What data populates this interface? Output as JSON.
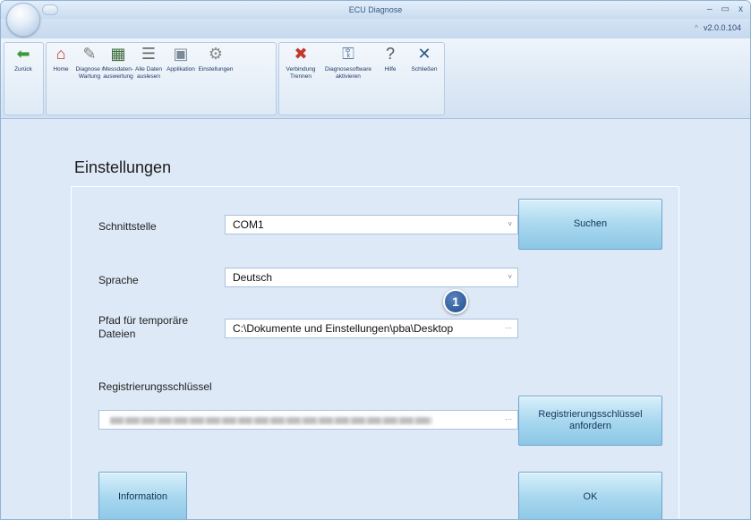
{
  "window": {
    "title": "ECU Diagnose",
    "controls": [
      "–",
      "▭",
      "x"
    ],
    "version": "v2.0.0.104",
    "version_caret": "^"
  },
  "ribbon": {
    "buttons": [
      {
        "label": "Zurück",
        "icon": "back-arrow-icon",
        "glyph": "⬅",
        "color": "#3a9a3a"
      },
      {
        "label": "Home",
        "icon": "home-icon",
        "glyph": "⌂",
        "color": "#c0392b"
      },
      {
        "label": "Diagnose / Wartung",
        "icon": "tools-icon",
        "glyph": "✎",
        "color": "#7a7a7a"
      },
      {
        "label": "Messdaten-auswertung",
        "icon": "measurement-icon",
        "glyph": "▦",
        "color": "#3a6a3a"
      },
      {
        "label": "Alle Daten auslesen",
        "icon": "database-icon",
        "glyph": "☰",
        "color": "#6a6a6a"
      },
      {
        "label": "Applikation",
        "icon": "application-icon",
        "glyph": "▣",
        "color": "#7a8a9a"
      },
      {
        "label": "Einstellungen",
        "icon": "gears-icon",
        "glyph": "⚙",
        "color": "#8a8a8a"
      },
      {
        "label": "Verbindung Trennen",
        "icon": "disconnect-icon",
        "glyph": "✖",
        "color": "#c0392b"
      },
      {
        "label": "Diagnosesoftware aktivieren",
        "icon": "activate-icon",
        "glyph": "⚿",
        "color": "#5a7aa0"
      },
      {
        "label": "Hilfe",
        "icon": "help-icon",
        "glyph": "?",
        "color": "#555"
      },
      {
        "label": "Schließen",
        "icon": "close-tools-icon",
        "glyph": "✕",
        "color": "#2a5a8a"
      }
    ]
  },
  "settings": {
    "title": "Einstellungen",
    "interface_label": "Schnittstelle",
    "interface_value": "COM1",
    "language_label": "Sprache",
    "language_value": "Deutsch",
    "path_label": "Pfad für temporäre Dateien",
    "path_value": "C:\\Dokumente und Einstellungen\\pba\\Desktop",
    "registration_label": "Registrierungsschlüssel",
    "search_button": "Suchen",
    "request_key_button": "Registrierungsschlüssel anfordern",
    "information_button": "Information",
    "ok_button": "OK",
    "callout_number": "1",
    "dropdown_glyph": "˅",
    "ellipsis": "···"
  }
}
